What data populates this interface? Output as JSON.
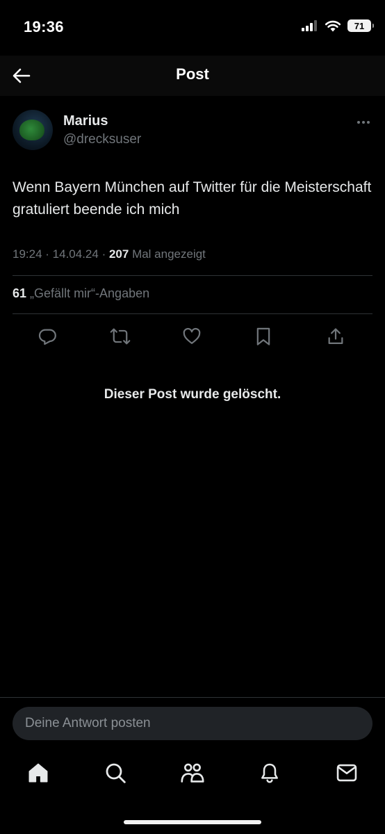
{
  "status_bar": {
    "time": "19:36",
    "battery": "71"
  },
  "header": {
    "title": "Post"
  },
  "author": {
    "name": "Marius",
    "handle": "@drecksuser"
  },
  "post": {
    "text": "Wenn Bayern München auf Twitter für die Meisterschaft gratuliert beende ich mich",
    "time": "19:24",
    "date": "14.04.24",
    "views_count": "207",
    "views_label": "Mal angezeigt",
    "likes_count": "61",
    "likes_label": "„Gefällt mir“-Angaben"
  },
  "deleted_notice": "Dieser Post wurde gelöscht.",
  "reply": {
    "placeholder": "Deine Antwort posten"
  },
  "icons": {
    "actions": [
      "reply-icon",
      "repost-icon",
      "like-icon",
      "bookmark-icon",
      "share-icon"
    ],
    "nav": [
      "home-icon",
      "search-icon",
      "communities-icon",
      "notifications-icon",
      "messages-icon"
    ]
  },
  "colors": {
    "background": "#000000",
    "text": "#e7e9ea",
    "secondary": "#71767b",
    "divider": "#2f3336"
  }
}
